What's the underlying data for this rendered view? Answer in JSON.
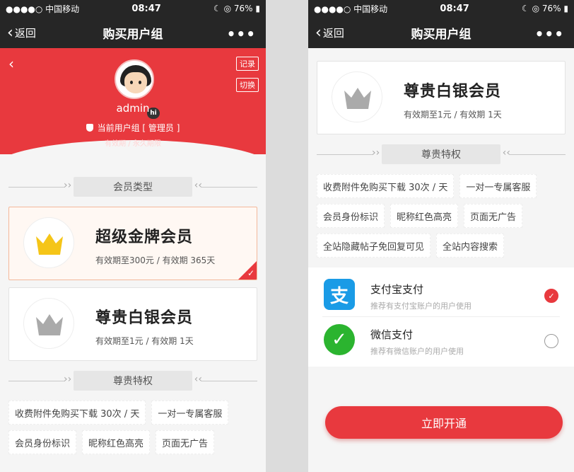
{
  "status_bar": {
    "carrier": "●●●●○ 中国移动",
    "time": "08:47",
    "battery": "☾ ◎ 76% ▮"
  },
  "navbar": {
    "back_label": "返回",
    "title": "购买用户组",
    "more": "•••"
  },
  "profile": {
    "record_label": "记录",
    "switch_label": "切换",
    "hi_badge": "hi",
    "username": "admin",
    "current_group": "当前用户组 [ 管理员 ]",
    "validity": "有效期 / 永久期限"
  },
  "sections": {
    "member_type": "会员类型",
    "privileges": "尊贵特权"
  },
  "members": [
    {
      "name": "超级金牌会员",
      "desc": "有效期至300元 / 有效期 365天",
      "selected": true,
      "crown_color": "#f5c518"
    },
    {
      "name": "尊贵白银会员",
      "desc": "有效期至1元 / 有效期 1天",
      "selected": false,
      "crown_color": "#aaaaaa"
    }
  ],
  "privileges": [
    "收费附件免购买下载 30次 / 天",
    "一对一专属客服",
    "会员身份标识",
    "昵称红色高亮",
    "页面无广告",
    "全站隐藏帖子免回复可见",
    "全站内容搜索"
  ],
  "payment": [
    {
      "title": "支付宝支付",
      "sub": "推荐有支付宝账户的用户使用",
      "icon": "alipay-icon",
      "icon_glyph": "支",
      "color": "#1a9be6",
      "checked": true
    },
    {
      "title": "微信支付",
      "sub": "推荐有微信账户的用户使用",
      "icon": "wechat-icon",
      "icon_glyph": "✓",
      "color": "#2bb42f",
      "checked": false
    }
  ],
  "open_button": "立即开通",
  "colors": {
    "accent": "#e8393e",
    "bar": "#262626"
  }
}
